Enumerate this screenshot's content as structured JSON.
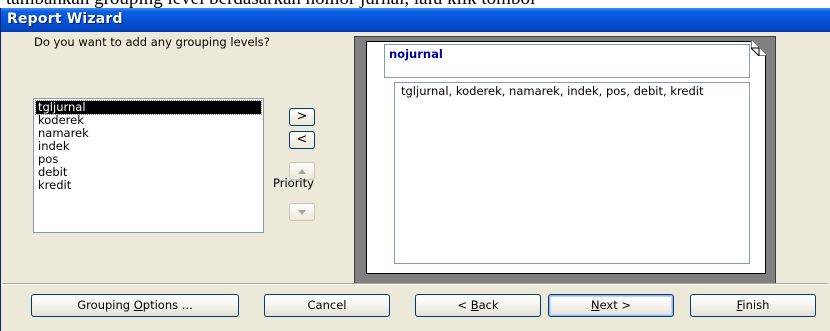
{
  "window": {
    "title": "Report Wizard"
  },
  "background_doc": {
    "text": "tambahkan grouping level berdasarkan nomor jurnal, lalu klik tombol"
  },
  "grouping": {
    "question": "Do you want to add any grouping levels?",
    "fields": [
      "tgljurnal",
      "koderek",
      "namarek",
      "indek",
      "pos",
      "debit",
      "kredit"
    ],
    "selected_field": "tgljurnal",
    "add_label": ">",
    "remove_label": "<",
    "priority_label": "Priority"
  },
  "preview": {
    "group_header": "nojurnal",
    "detail_fields": "tgljurnal, koderek, namarek, indek, pos, debit, kredit"
  },
  "buttons": {
    "grouping_options": {
      "pre": "Grouping ",
      "accel": "O",
      "post": "ptions ..."
    },
    "cancel": "Cancel",
    "back": {
      "pre": "< ",
      "accel": "B",
      "post": "ack"
    },
    "next": {
      "pre": "",
      "accel": "N",
      "post": "ext >"
    },
    "finish": {
      "pre": "",
      "accel": "F",
      "post": "inish"
    }
  },
  "colors": {
    "titlebar": "#0553d9",
    "dialog_bg": "#ece9d8",
    "header_text": "#0000a0",
    "preview_bg": "#808080"
  }
}
